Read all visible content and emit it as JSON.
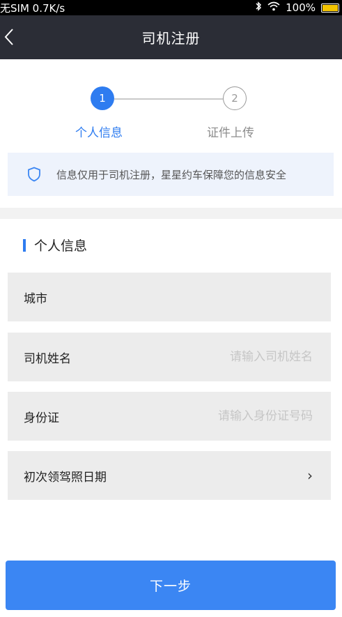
{
  "status_bar": {
    "carrier": "无SIM 0.7K/s",
    "bluetooth_icon": "bluetooth-icon",
    "wifi_icon": "wifi-icon",
    "battery": "100%",
    "battery_level": 1.0,
    "battery_color": "#f3c400"
  },
  "nav": {
    "title": "司机注册",
    "back_icon": "chevron-left-icon"
  },
  "steps": {
    "step1_number": "1",
    "step1_label": "个人信息",
    "step2_number": "2",
    "step2_label": "证件上传",
    "active_color": "#2e7cf0"
  },
  "notice": {
    "icon": "shield-icon",
    "text": "信息仅用于司机注册，星星约车保障您的信息安全"
  },
  "section": {
    "title": "个人信息"
  },
  "form": {
    "city_label": "城市",
    "name_label": "司机姓名",
    "name_placeholder": "请输入司机姓名",
    "id_label": "身份证",
    "id_placeholder": "请输入身份证号码",
    "license_date_label": "初次领驾照日期",
    "license_date_chevron": "›"
  },
  "next_button": {
    "label": "下一步",
    "color": "#3b86f3"
  }
}
